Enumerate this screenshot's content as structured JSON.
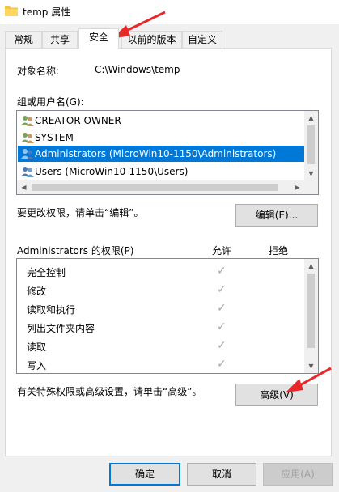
{
  "window": {
    "title": "temp 属性"
  },
  "tabs": [
    {
      "label": "常规"
    },
    {
      "label": "共享"
    },
    {
      "label": "安全"
    },
    {
      "label": "以前的版本"
    },
    {
      "label": "自定义"
    }
  ],
  "active_tab": "安全",
  "security": {
    "object_name_label": "对象名称:",
    "object_name_value": "C:\\Windows\\temp",
    "groups_label": "组或用户名(G):",
    "groups": [
      {
        "name": "CREATOR OWNER",
        "selected": false
      },
      {
        "name": "SYSTEM",
        "selected": false
      },
      {
        "name": "Administrators (MicroWin10-1150\\Administrators)",
        "selected": true
      },
      {
        "name": "Users (MicroWin10-1150\\Users)",
        "selected": false
      }
    ],
    "edit_hint": "要更改权限，请单击“编辑”。",
    "edit_button": "编辑(E)...",
    "permissions_label": "Administrators 的权限(P)",
    "allow_header": "允许",
    "deny_header": "拒绝",
    "permissions": [
      {
        "name": "完全控制",
        "allow": true,
        "deny": false
      },
      {
        "name": "修改",
        "allow": true,
        "deny": false
      },
      {
        "name": "读取和执行",
        "allow": true,
        "deny": false
      },
      {
        "name": "列出文件夹内容",
        "allow": true,
        "deny": false
      },
      {
        "name": "读取",
        "allow": true,
        "deny": false
      },
      {
        "name": "写入",
        "allow": true,
        "deny": false
      }
    ],
    "advanced_hint": "有关特殊权限或高级设置，请单击“高级”。",
    "advanced_button": "高级(V)"
  },
  "dialog_buttons": {
    "ok": "确定",
    "cancel": "取消",
    "apply": "应用(A)"
  },
  "colors": {
    "selection": "#0078d7",
    "annotation_arrow": "#e8272b"
  },
  "icons": {
    "title": "folder-icon",
    "group_rows": "user-group-icon",
    "permission_checks": "checkmark-icon",
    "annotations": "red-arrow-icon"
  }
}
